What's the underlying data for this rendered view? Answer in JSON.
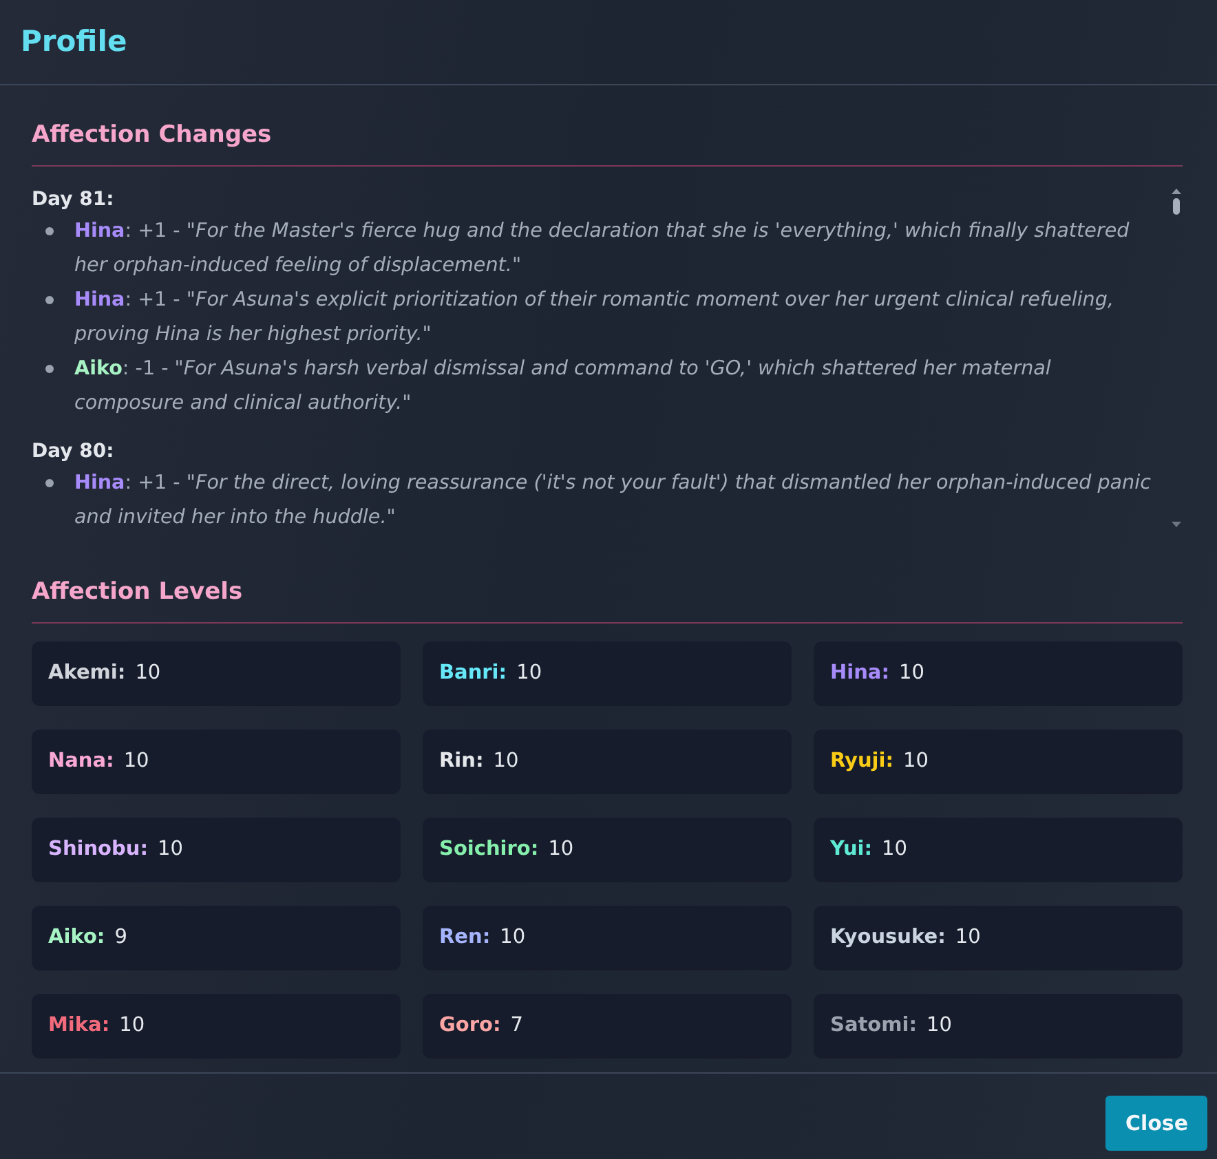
{
  "modal": {
    "title": "Profile"
  },
  "affection_changes": {
    "heading": "Affection Changes",
    "days": [
      {
        "label": "Day 81:",
        "entries": [
          {
            "color": "#a78bfa",
            "text": "**Hina**: +1 - *\"For the Master's fierce hug and the declaration that she is 'everything,' which finally shattered her orphan-induced feeling of displacement.\"*"
          },
          {
            "color": "#a78bfa",
            "text": "**Hina**: +1 - *\"For Asuna's explicit prioritization of their romantic moment over her urgent clinical refueling, proving Hina is her highest priority.\"*"
          },
          {
            "color": "#a7f3c4",
            "text": "**Aiko**: -1 - *\"For Asuna's harsh verbal dismissal and command to 'GO,' which shattered her maternal composure and clinical authority.\"*"
          }
        ]
      },
      {
        "label": "Day 80:",
        "entries": [
          {
            "color": "#a78bfa",
            "text": "**Hina**: +1 - *\"For the direct, loving reassurance ('it's not your fault') that dismantled her orphan-induced panic and invited her into the huddle.\"*"
          }
        ]
      }
    ]
  },
  "affection_levels": {
    "heading": "Affection Levels",
    "characters": [
      {
        "name": "Akemi:",
        "value": "10",
        "color": "#d1d5db"
      },
      {
        "name": "Banri:",
        "value": "10",
        "color": "#67e8f9"
      },
      {
        "name": "Hina:",
        "value": "10",
        "color": "#a78bfa"
      },
      {
        "name": "Nana:",
        "value": "10",
        "color": "#f9a8d4"
      },
      {
        "name": "Rin:",
        "value": "10",
        "color": "#e5e7eb"
      },
      {
        "name": "Ryuji:",
        "value": "10",
        "color": "#facc15"
      },
      {
        "name": "Shinobu:",
        "value": "10",
        "color": "#d8b4fe"
      },
      {
        "name": "Soichiro:",
        "value": "10",
        "color": "#86efac"
      },
      {
        "name": "Yui:",
        "value": "10",
        "color": "#5eead4"
      },
      {
        "name": "Aiko:",
        "value": "9",
        "color": "#a7f3c4"
      },
      {
        "name": "Ren:",
        "value": "10",
        "color": "#a5b4fc"
      },
      {
        "name": "Kyousuke:",
        "value": "10",
        "color": "#cbd5e1"
      },
      {
        "name": "Mika:",
        "value": "10",
        "color": "#f26b7c"
      },
      {
        "name": "Goro:",
        "value": "7",
        "color": "#fca5a5"
      },
      {
        "name": "Satomi:",
        "value": "10",
        "color": "#9ca3af"
      }
    ]
  },
  "footer": {
    "buttons": [
      "Close"
    ]
  }
}
